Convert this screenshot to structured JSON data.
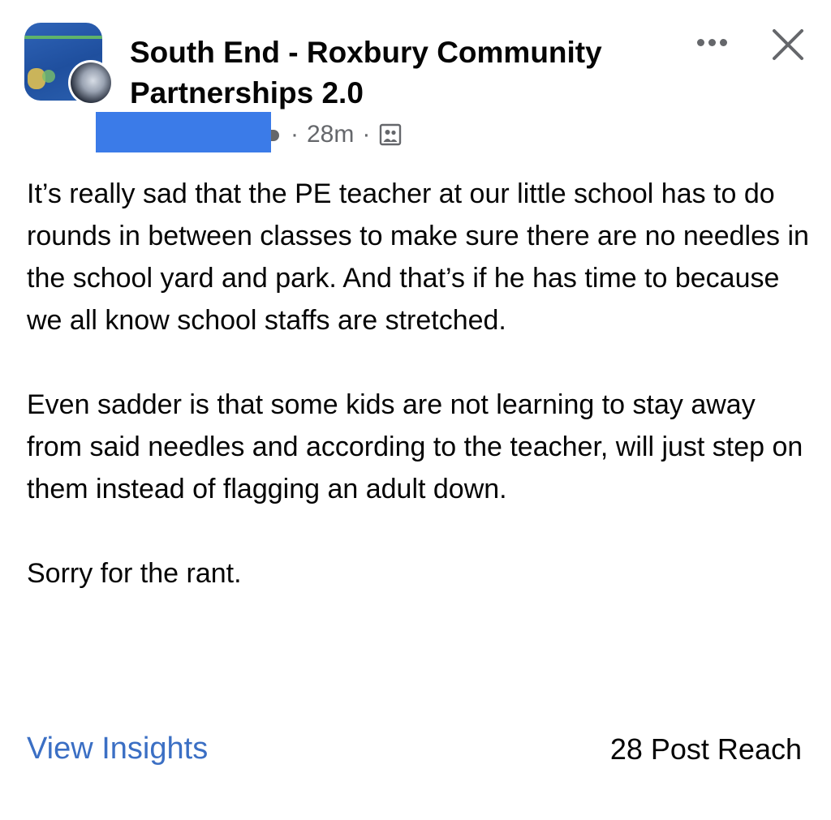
{
  "header": {
    "group_name": "South End - Roxbury Community Partnerships 2.0",
    "more_icon": "more-horizontal-icon",
    "close_icon": "close-icon"
  },
  "meta": {
    "time_ago": "28m",
    "separator": "·",
    "audience_icon": "members-icon"
  },
  "post": {
    "paragraphs": [
      "It’s really sad that the PE teacher at our little school has to do rounds in between classes to make sure there are no needles in the school yard and park. And that’s if he has time to because we all know school staffs are stretched.",
      "Even sadder is that some kids are not learning to stay away from said needles and according to the teacher, will just step on them instead of flagging an adult down.",
      "Sorry for the rant."
    ]
  },
  "footer": {
    "insights_label": "View Insights",
    "reach_label": "28 Post Reach"
  },
  "colors": {
    "link_blue": "#3b6fc4",
    "redaction_blue": "#3b7be8",
    "secondary_gray": "#65676b",
    "text": "#050505"
  }
}
